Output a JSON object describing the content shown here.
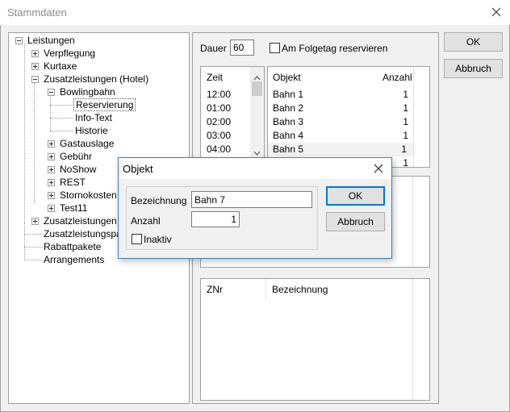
{
  "window": {
    "title": "Stammdaten"
  },
  "tree": {
    "items": [
      {
        "label": "Leistungen"
      },
      {
        "label": "Verpflegung"
      },
      {
        "label": "Kurtaxe"
      },
      {
        "label": "Zusatzleistungen (Hotel)"
      },
      {
        "label": "Bowlingbahn"
      },
      {
        "label": "Reservierung"
      },
      {
        "label": "Info-Text"
      },
      {
        "label": "Historie"
      },
      {
        "label": "Gastauslage"
      },
      {
        "label": "Gebühr"
      },
      {
        "label": "NoShow"
      },
      {
        "label": "REST"
      },
      {
        "label": "Stornokosten"
      },
      {
        "label": "Test11"
      },
      {
        "label": "Zusatzleistungen (V"
      },
      {
        "label": "Zusatzleistungspak"
      },
      {
        "label": "Rabattpakete"
      },
      {
        "label": "Arrangements"
      }
    ]
  },
  "form": {
    "dauer_label": "Dauer",
    "dauer_value": "60",
    "folgetag_label": "Am Folgetag reservieren"
  },
  "time_list": {
    "header": "Zeit",
    "items": [
      "12:00",
      "01:00",
      "02:00",
      "03:00",
      "04:00"
    ]
  },
  "objekt_table": {
    "headers": [
      "Objekt",
      "Anzahl"
    ],
    "rows": [
      {
        "objekt": "Bahn 1",
        "anzahl": "1"
      },
      {
        "objekt": "Bahn 2",
        "anzahl": "1"
      },
      {
        "objekt": "Bahn 3",
        "anzahl": "1"
      },
      {
        "objekt": "Bahn 4",
        "anzahl": "1"
      },
      {
        "objekt": "Bahn 5",
        "anzahl": "1"
      },
      {
        "objekt": "",
        "anzahl": "1"
      }
    ]
  },
  "zn_table": {
    "headers": [
      "ZNr",
      "Bezeichnung"
    ]
  },
  "main_buttons": {
    "ok": "OK",
    "cancel": "Abbruch"
  },
  "dialog": {
    "title": "Objekt",
    "bezeichnung_label": "Bezeichnung",
    "bezeichnung_value": "Bahn 7",
    "anzahl_label": "Anzahl",
    "anzahl_value": "1",
    "inaktiv_label": "Inaktiv",
    "ok": "OK",
    "cancel": "Abbruch"
  }
}
